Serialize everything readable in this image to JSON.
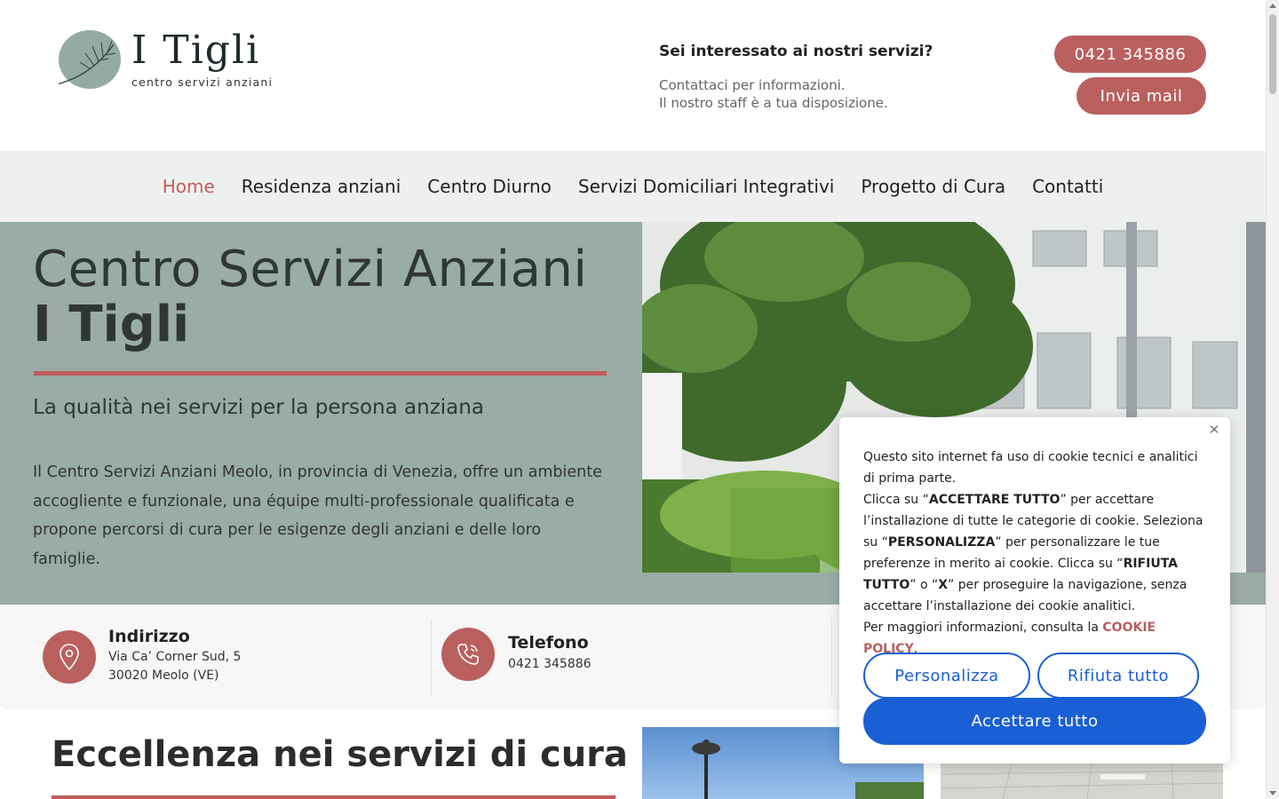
{
  "header": {
    "logo_title": "I Tigli",
    "logo_subtitle": "centro servizi anziani",
    "contact_question": "Sei interessato ai nostri servizi?",
    "contact_line1": "Contattaci per informazioni.",
    "contact_line2": "Il nostro staff è a tua disposizione.",
    "phone_button": "0421 345886",
    "mail_button": "Invia mail"
  },
  "nav": {
    "items": [
      {
        "label": "Home",
        "active": true
      },
      {
        "label": "Residenza anziani"
      },
      {
        "label": "Centro Diurno"
      },
      {
        "label": "Servizi Domiciliari Integrativi"
      },
      {
        "label": "Progetto di Cura"
      },
      {
        "label": "Contatti"
      }
    ]
  },
  "hero": {
    "title_line1": "Centro Servizi Anziani",
    "title_line2": "I Tigli",
    "subtitle": "La qualità nei servizi per la persona anziana",
    "text": "Il Centro Servizi Anziani Meolo, in provincia di Venezia, offre un ambiente accogliente e funzionale, una équipe multi-professionale qualificata e propone percorsi di cura per le esigenze degli anziani e delle loro famiglie."
  },
  "info": {
    "address_title": "Indirizzo",
    "address_line1": "Via Ca’ Corner Sud, 5",
    "address_line2": "30020 Meolo (VE)",
    "phone_title": "Telefono",
    "phone_line": "0421 345886"
  },
  "section": {
    "title": "Eccellenza nei servizi di cura"
  },
  "cookie": {
    "p1": "Questo sito internet fa uso di cookie tecnici e analitici di prima parte.",
    "p2a": "Clicca su “",
    "p2b": "ACCETTARE TUTTO",
    "p2c": "” per accettare l’installazione di tutte le categorie di cookie. Seleziona su “",
    "p2d": "PERSONALIZZA",
    "p2e": "” per personalizzare le tue preferenze in merito ai cookie. Clicca su “",
    "p2f": "RIFIUTA TUTTO",
    "p2g": "” o “",
    "p2h": "X",
    "p2i": "” per proseguire la navigazione, senza accettare l’installazione dei cookie analitici.",
    "p3": "Per maggiori informazioni, consulta la ",
    "policy_link": "COOKIE POLICY",
    "p3end": ".",
    "btn_customize": "Personalizza",
    "btn_reject": "Rifiuta tutto",
    "btn_accept": "Accettare tutto",
    "close_glyph": "✕"
  },
  "colors": {
    "accent_red": "#b9605f",
    "hero_bg": "#99aca6",
    "nav_bg": "#eef0ef",
    "cookie_blue": "#1a5fd6"
  }
}
